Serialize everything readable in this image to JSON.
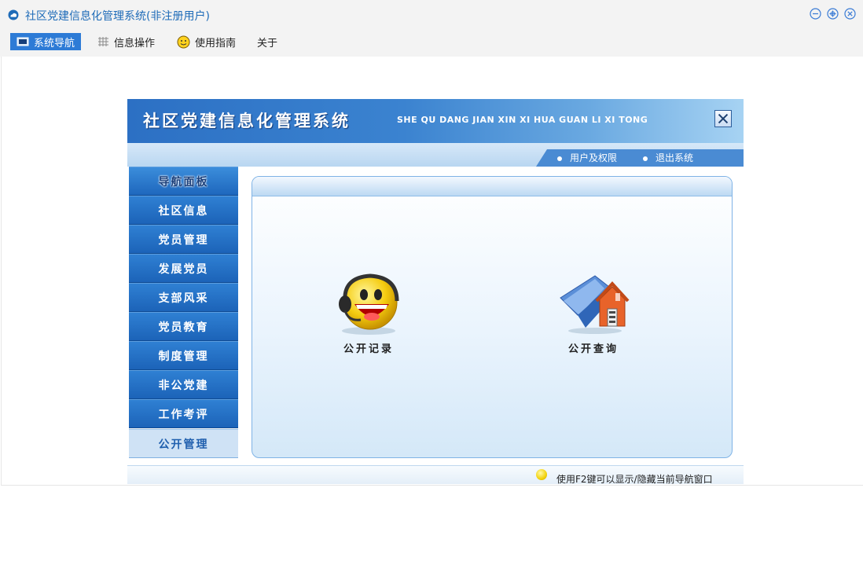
{
  "window": {
    "title": "社区党建信息化管理系统(非注册用户)",
    "app_icon": "cloud-icon",
    "controls": [
      "minimize-icon",
      "maximize-icon",
      "close-icon"
    ],
    "accent_color": "#1e6bb8"
  },
  "menu": {
    "items": [
      {
        "label": "系统导航",
        "icon": "monitor-icon",
        "active": true
      },
      {
        "label": "信息操作",
        "icon": "grid-icon",
        "active": false
      },
      {
        "label": "使用指南",
        "icon": "smiley-icon",
        "active": false
      },
      {
        "label": "关于",
        "icon": "",
        "active": false
      }
    ],
    "active_color": "#2d7bd6"
  },
  "app": {
    "title": "社区党建信息化管理系统",
    "pinyin": "SHE QU DANG JIAN XIN XI HUA GUAN LI XI TONG",
    "close_icon": "close-x-icon",
    "links": [
      "用户及权限",
      "退出系统"
    ],
    "nav": {
      "header": "导航面板",
      "items": [
        "社区信息",
        "党员管理",
        "发展党员",
        "支部风采",
        "党员教育",
        "制度管理",
        "非公党建",
        "工作考评",
        "公开管理"
      ],
      "selected": "公开管理"
    },
    "actions": [
      {
        "label": "公开记录",
        "icon": "headset-smiley-icon"
      },
      {
        "label": "公开查询",
        "icon": "folder-house-icon"
      }
    ],
    "footer_tip": "使用F2键可以显示/隐藏当前导航窗口",
    "footer_icon": "bulb-icon"
  }
}
